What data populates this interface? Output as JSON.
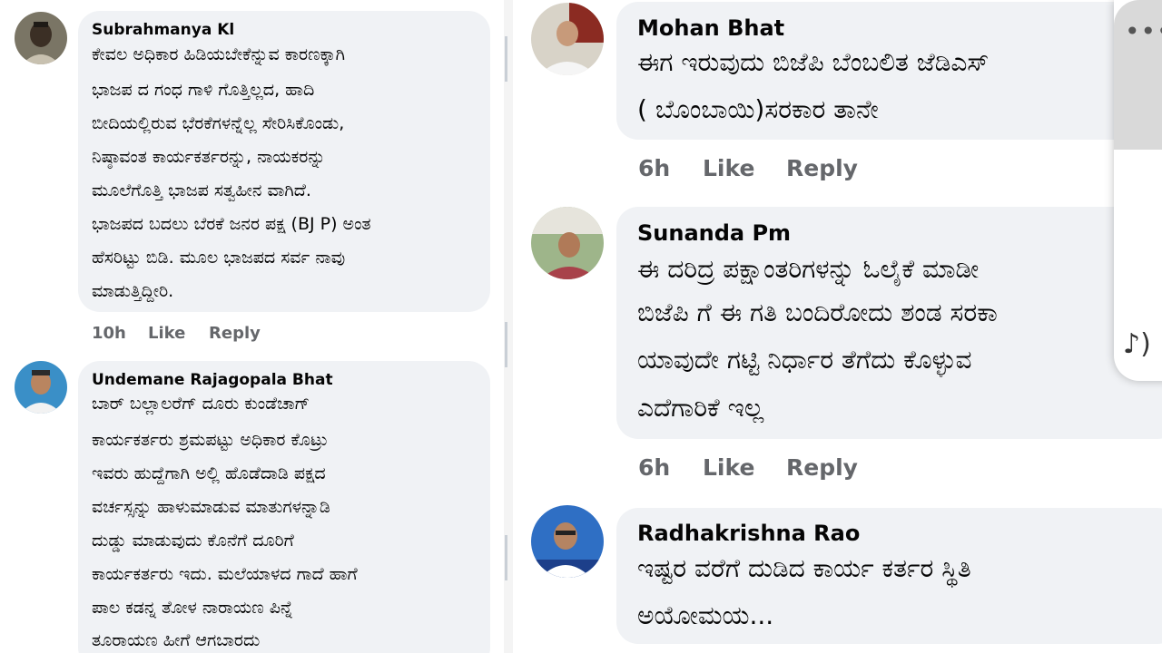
{
  "left_comments": [
    {
      "author": "Subrahmanya Kl",
      "lines": [
        "ಕೇವಲ ಅಧಿಕಾರ ಹಿಡಿಯಬೇಕೆನ್ನುವ ಕಾರಣಕ್ಕಾಗಿ",
        "ಭಾಜಪ ದ ಗಂಧ ಗಾಳಿ ಗೊತ್ತಿಲ್ಲದ, ಹಾದಿ",
        "ಬೀದಿಯಲ್ಲಿರುವ ಭೆರಕೆಗಳನ್ನೆಲ್ಲ ಸೇರಿಸಿಕೊಂಡು,",
        "ನಿಷ್ಠಾವಂತ ಕಾರ್ಯಕರ್ತರನ್ನು, ನಾಯಕರನ್ನು",
        "ಮೂಲೆಗೊತ್ತಿ ಭಾಜಪ ಸತ್ವಹೀನ ವಾಗಿದೆ.",
        "ಭಾಜಪದ ಬದಲು ಬೆರಕೆ ಜನರ ಪಕ್ಷ (BJ P) ಅಂತ",
        "ಹೆಸರಿಟ್ಟು ಬಿಡಿ. ಮೂಲ ಭಾಜಪದ ಸರ್ವ ನಾವು",
        "ಮಾಡುತ್ತಿದ್ದೀರಿ."
      ],
      "time": "10h",
      "like": "Like",
      "reply": "Reply"
    },
    {
      "author": "Undemane Rajagopala Bhat",
      "lines": [
        "ಬಾರ್ ಬಲ್ಲಾಲರೆಗ್ ದೂರು ಕುಂಡೆಚಾಗ್",
        "ಕಾರ್ಯಕರ್ತರು ಶ್ರಮಪಟ್ಟು ಅಧಿಕಾರ ಕೊಟ್ರು",
        "ಇವರು ಹುದ್ದೆಗಾಗಿ ಅಲ್ಲಿ ಹೊಡೆದಾಡಿ ಪಕ್ಷದ",
        "ವರ್ಚಸ್ಸನ್ನು ಹಾಳುಮಾಡುವ  ಮಾತುಗಳನ್ನಾಡಿ",
        "ದುಡ್ಡು ಮಾಡುವುದು ಕೊನೆಗೆ ದೂರಿಗೆ",
        "ಕಾರ್ಯಕರ್ತರು ಇದು. ಮಲೆಯಾಳದ ಗಾದೆ ಹಾಗೆ",
        "ಪಾಲ ಕಡನ್ನ ತೋಳ ನಾರಾಯಣ ಪಿನ್ನೆ",
        "ತೂರಾಯಣ ಹೀಗೆ ಆಗಬಾರದು"
      ]
    }
  ],
  "right_comments": [
    {
      "author": "Mohan Bhat",
      "lines": [
        "ಈಗ ಇರುವುದು ಬಿಜೆಪಿ ಬೆಂಬಲಿತ ಜೆಡಿಎಸ್",
        "( ಬೊಂಬಾಯಿ)ಸರಕಾರ ತಾನೇ"
      ],
      "time": "6h",
      "like": "Like",
      "reply": "Reply"
    },
    {
      "author": "Sunanda Pm",
      "lines": [
        "ಈ ದರಿದ್ರ  ಪಕ್ಷಾಂತರಿಗಳನ್ನು ಓಲೈಕೆ  ಮಾಡೀ",
        "ಬಿಜೆಪಿ ಗೆ ಈ ಗತಿ ಬಂದಿರೋದು  ಶಂಡ ಸರಕಾ",
        "ಯಾವುದೇ  ಗಟ್ಟಿ  ನಿರ್ಧಾರ  ತೆಗೆದು ಕೊಳ್ಳುವ",
        "ಎದೆಗಾರಿಕೆ ಇಲ್ಲ"
      ],
      "time": "6h",
      "like": "Like",
      "reply": "Reply"
    },
    {
      "author": "Radhakrishna Rao",
      "lines": [
        "ಇಷ್ಟರ ವರೆಗೆ ದುಡಿದ ಕಾರ್ಯ ಕರ್ತರ ಸ್ಥಿತಿ",
        "ಅಯೋಮಯ..."
      ]
    }
  ],
  "overlay": {
    "menu_icon": "more-dots-icon",
    "menu_glyph": "•••",
    "speaker_icon": "speaker-icon",
    "speaker_glyph": "♪)"
  },
  "colors": {
    "bubble": "#f0f2f5",
    "meta_text": "#65676b",
    "text": "#050505"
  }
}
